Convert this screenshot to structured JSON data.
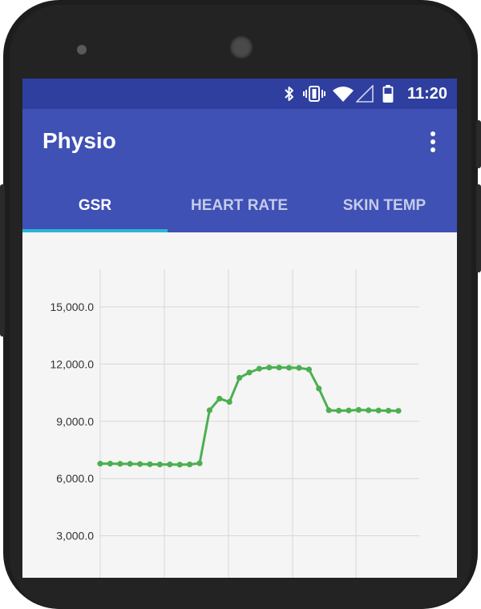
{
  "status_bar": {
    "time": "11:20",
    "icons": [
      "bluetooth-icon",
      "vibrate-icon",
      "wifi-icon",
      "signal-icon",
      "battery-icon"
    ]
  },
  "app_bar": {
    "title": "Physio",
    "overflow_icon": "more-vert-icon"
  },
  "tabs": [
    {
      "label": "GSR",
      "selected": true
    },
    {
      "label": "HEART RATE",
      "selected": false
    },
    {
      "label": "SKIN TEMP",
      "selected": false
    }
  ],
  "colors": {
    "primary": "#3f51b5",
    "primary_dark": "#2f3f9f",
    "accent": "#29b6d6",
    "series": "#4caf50"
  },
  "chart_data": {
    "type": "line",
    "title": "",
    "xlabel": "",
    "ylabel": "",
    "ylim": [
      0,
      16000
    ],
    "yticks": [
      3000,
      6000,
      9000,
      12000,
      15000
    ],
    "ytick_labels": [
      "3,000.0",
      "6,000.0",
      "9,000.0",
      "12,000.0",
      "15,000.0"
    ],
    "x": [
      0,
      1,
      2,
      3,
      4,
      5,
      6,
      7,
      8,
      9,
      10,
      11,
      12,
      13,
      14,
      15,
      16,
      17,
      18,
      19,
      20,
      21,
      22,
      23,
      24,
      25,
      26,
      27,
      28,
      29,
      30
    ],
    "series": [
      {
        "values": [
          6780,
          6780,
          6770,
          6770,
          6760,
          6750,
          6740,
          6740,
          6730,
          6740,
          6800,
          9580,
          10190,
          10020,
          11280,
          11560,
          11760,
          11820,
          11820,
          11810,
          11800,
          11720,
          10720,
          9580,
          9560,
          9570,
          9600,
          9580,
          9570,
          9560,
          9550
        ]
      }
    ],
    "grid": true,
    "legend": "none"
  }
}
